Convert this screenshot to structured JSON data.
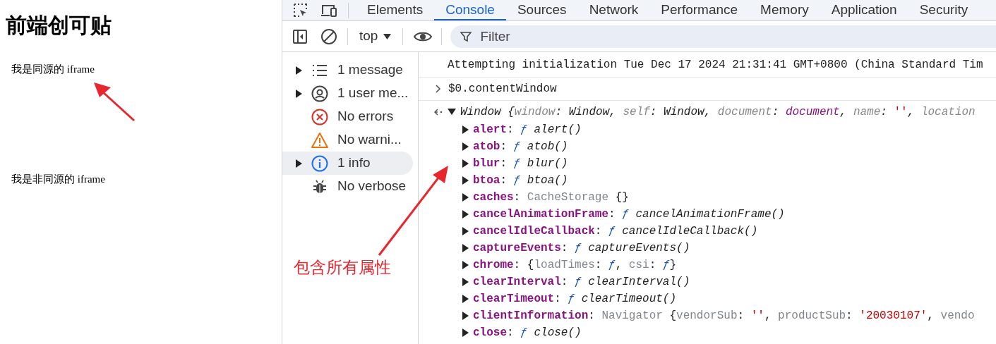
{
  "page": {
    "title": "前端创可贴",
    "iframes": [
      "我是同源的 iframe",
      "我是非同源的 iframe"
    ]
  },
  "devtools": {
    "tabs": [
      {
        "label": "Elements",
        "selected": false
      },
      {
        "label": "Console",
        "selected": true
      },
      {
        "label": "Sources",
        "selected": false
      },
      {
        "label": "Network",
        "selected": false
      },
      {
        "label": "Performance",
        "selected": false
      },
      {
        "label": "Memory",
        "selected": false
      },
      {
        "label": "Application",
        "selected": false
      },
      {
        "label": "Security",
        "selected": false
      }
    ],
    "toolbar": {
      "context": "top",
      "filter_placeholder": "Filter"
    },
    "sidebar": [
      {
        "kind": "list",
        "label": "1 message",
        "expandable": true,
        "selected": false
      },
      {
        "kind": "user",
        "label": "1 user me...",
        "expandable": true,
        "selected": false
      },
      {
        "kind": "error",
        "label": "No errors",
        "expandable": false,
        "selected": false
      },
      {
        "kind": "warning",
        "label": "No warni...",
        "expandable": false,
        "selected": false
      },
      {
        "kind": "info",
        "label": "1 info",
        "expandable": true,
        "selected": true
      },
      {
        "kind": "bug",
        "label": "No verbose",
        "expandable": false,
        "selected": false
      }
    ],
    "console": {
      "log": "Attempting initialization Tue Dec 17 2024 21:31:41 GMT+0800 (China Standard Tim",
      "input": "$0.contentWindow",
      "result": [
        {
          "kind": "italic",
          "text": "Window {"
        },
        {
          "kind": "preview-key",
          "text": "window"
        },
        {
          "kind": "italic",
          "text": ": Window, "
        },
        {
          "kind": "preview-key",
          "text": "self"
        },
        {
          "kind": "italic",
          "text": ": Window, "
        },
        {
          "kind": "preview-key",
          "text": "document"
        },
        {
          "kind": "italic",
          "text": ": "
        },
        {
          "kind": "purple",
          "text": "document"
        },
        {
          "kind": "italic",
          "text": ", "
        },
        {
          "kind": "preview-key",
          "text": "name"
        },
        {
          "kind": "italic",
          "text": ": "
        },
        {
          "kind": "string",
          "text": "''"
        },
        {
          "kind": "italic",
          "text": ", "
        },
        {
          "kind": "preview-key",
          "text": "location"
        }
      ],
      "properties": [
        {
          "key": "alert",
          "separator": ": ",
          "value": [
            {
              "kind": "f",
              "text": "ƒ"
            },
            {
              "kind": "italic",
              "text": " alert()"
            }
          ]
        },
        {
          "key": "atob",
          "separator": ": ",
          "value": [
            {
              "kind": "f",
              "text": "ƒ"
            },
            {
              "kind": "italic",
              "text": " atob()"
            }
          ]
        },
        {
          "key": "blur",
          "separator": ": ",
          "value": [
            {
              "kind": "f",
              "text": "ƒ"
            },
            {
              "kind": "italic",
              "text": " blur()"
            }
          ]
        },
        {
          "key": "btoa",
          "separator": ": ",
          "value": [
            {
              "kind": "f",
              "text": "ƒ"
            },
            {
              "kind": "italic",
              "text": " btoa()"
            }
          ]
        },
        {
          "key": "caches",
          "separator": ": ",
          "value": [
            {
              "kind": "gray",
              "text": "CacheStorage"
            },
            {
              "kind": "plain",
              "text": " {}"
            }
          ]
        },
        {
          "key": "cancelAnimationFrame",
          "separator": ": ",
          "value": [
            {
              "kind": "f",
              "text": "ƒ"
            },
            {
              "kind": "italic",
              "text": " cancelAnimationFrame()"
            }
          ]
        },
        {
          "key": "cancelIdleCallback",
          "separator": ": ",
          "value": [
            {
              "kind": "f",
              "text": "ƒ"
            },
            {
              "kind": "italic",
              "text": " cancelIdleCallback()"
            }
          ]
        },
        {
          "key": "captureEvents",
          "separator": ": ",
          "value": [
            {
              "kind": "f",
              "text": "ƒ"
            },
            {
              "kind": "italic",
              "text": " captureEvents()"
            }
          ]
        },
        {
          "key": "chrome",
          "separator": ": ",
          "value": [
            {
              "kind": "plain",
              "text": "{"
            },
            {
              "kind": "gray",
              "text": "loadTimes"
            },
            {
              "kind": "plain",
              "text": ": "
            },
            {
              "kind": "f",
              "text": "ƒ"
            },
            {
              "kind": "plain",
              "text": ", "
            },
            {
              "kind": "gray",
              "text": "csi"
            },
            {
              "kind": "plain",
              "text": ": "
            },
            {
              "kind": "f",
              "text": "ƒ"
            },
            {
              "kind": "plain",
              "text": "}"
            }
          ]
        },
        {
          "key": "clearInterval",
          "separator": ": ",
          "value": [
            {
              "kind": "f",
              "text": "ƒ"
            },
            {
              "kind": "italic",
              "text": " clearInterval()"
            }
          ]
        },
        {
          "key": "clearTimeout",
          "separator": ": ",
          "value": [
            {
              "kind": "f",
              "text": "ƒ"
            },
            {
              "kind": "italic",
              "text": " clearTimeout()"
            }
          ]
        },
        {
          "key": "clientInformation",
          "separator": ": ",
          "value": [
            {
              "kind": "gray",
              "text": "Navigator"
            },
            {
              "kind": "plain",
              "text": " {"
            },
            {
              "kind": "gray",
              "text": "vendorSub"
            },
            {
              "kind": "plain",
              "text": ": "
            },
            {
              "kind": "string",
              "text": "''"
            },
            {
              "kind": "plain",
              "text": ", "
            },
            {
              "kind": "gray",
              "text": "productSub"
            },
            {
              "kind": "plain",
              "text": ": "
            },
            {
              "kind": "string",
              "text": "'20030107'"
            },
            {
              "kind": "plain",
              "text": ", "
            },
            {
              "kind": "gray",
              "text": "vendo"
            }
          ]
        },
        {
          "key": "close",
          "separator": ": ",
          "value": [
            {
              "kind": "f",
              "text": "ƒ"
            },
            {
              "kind": "italic",
              "text": " close()"
            }
          ]
        }
      ]
    }
  },
  "annotation": {
    "label": "包含所有属性"
  }
}
